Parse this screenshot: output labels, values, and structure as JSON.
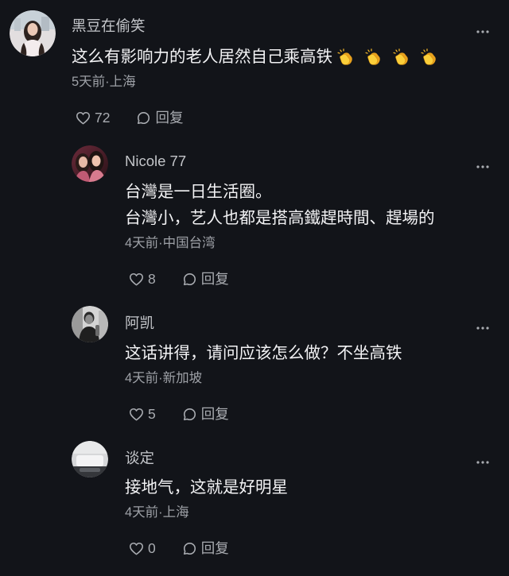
{
  "comments": [
    {
      "username": "黑豆在偷笑",
      "lines": [
        "这么有影响力的老人居然自己乘高铁"
      ],
      "emoji": [
        "clapping-hands-icon",
        "clapping-hands-icon",
        "clapping-hands-icon",
        "clapping-hands-icon"
      ],
      "meta": "5天前·上海",
      "likes": "72",
      "reply_label": "回复"
    },
    {
      "username": "Nicole 77",
      "lines": [
        "台灣是一日生活圈。",
        "台灣小，艺人也都是搭高鐵趕時間、趕場的"
      ],
      "meta": "4天前·中国台湾",
      "likes": "8",
      "reply_label": "回复"
    },
    {
      "username": "阿凯",
      "lines": [
        "这话讲得，请问应该怎么做？不坐高铁"
      ],
      "meta": "4天前·新加坡",
      "likes": "5",
      "reply_label": "回复"
    },
    {
      "username": "谈定",
      "lines": [
        "接地气，这就是好明星"
      ],
      "meta": "4天前·上海",
      "likes": "0",
      "reply_label": "回复"
    }
  ],
  "icons": {
    "like": "heart-outline-icon",
    "reply": "comment-bubble-icon",
    "more": "more-dots-icon",
    "emoji": "clapping-hands-icon"
  },
  "colors": {
    "background": "#121419",
    "text_primary": "#f2f2f4",
    "username": "#c3c5c9",
    "text_secondary": "#9da0a6",
    "icon": "#a9acb1",
    "emoji_yellow": "#fbcf3a"
  }
}
